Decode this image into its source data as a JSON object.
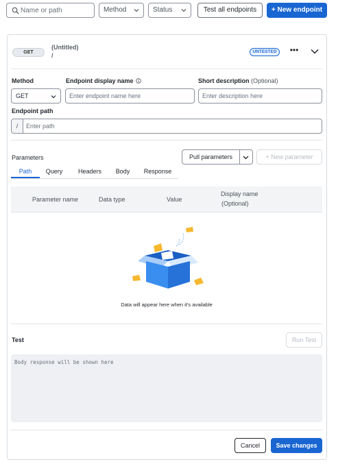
{
  "toolbar": {
    "search_placeholder": "Name or path",
    "method_filter": "Method",
    "status_filter": "Status",
    "test_all_label": "Test all endpoints",
    "new_endpoint_label": "+ New endpoint"
  },
  "endpoint": {
    "method_badge": "GET",
    "title": "(Untitled)",
    "path": "/",
    "status_badge": "UNTESTED",
    "more_label": "•••"
  },
  "form": {
    "method_label": "Method",
    "method_value": "GET",
    "display_name_label": "Endpoint display name",
    "display_name_placeholder": "Enter endpoint name here",
    "short_desc_label": "Short description",
    "short_desc_optional": "(Optional)",
    "short_desc_placeholder": "Enter description here",
    "path_label": "Endpoint path",
    "path_prefix": "/",
    "path_placeholder": "Enter path"
  },
  "parameters": {
    "title": "Parameters",
    "pull_label": "Pull parameters",
    "new_param_label": "+ New parameter",
    "tabs": [
      "Path",
      "Query",
      "Headers",
      "Body",
      "Response"
    ],
    "active_tab": "Path",
    "columns": {
      "name": "Parameter name",
      "type": "Data type",
      "value": "Value",
      "display": "Display name",
      "display_optional": "(Optional)"
    },
    "empty_message": "Data will appear here when it's available"
  },
  "test": {
    "title": "Test",
    "run_label": "Run Test",
    "response_placeholder": "Body response will be shown here"
  },
  "footer": {
    "cancel_label": "Cancel",
    "save_label": "Save changes"
  },
  "colors": {
    "primary": "#1966d2",
    "border": "#8a9099",
    "divider": "#e1e4e8",
    "table_header_bg": "#f2f4f6",
    "response_bg": "#eef0f3",
    "illustration_box": "#2f80e6",
    "illustration_paper": "#f5b82e"
  }
}
